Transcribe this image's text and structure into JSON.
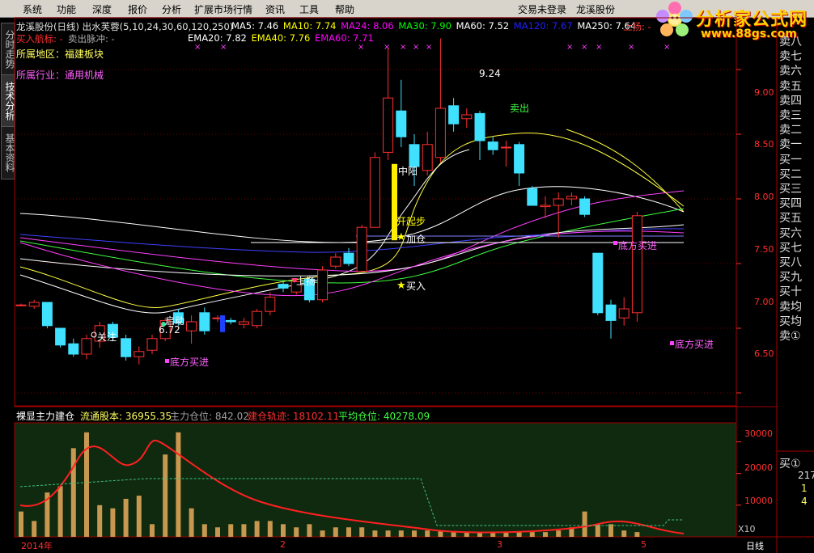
{
  "menu": [
    "系统",
    "功能",
    "深度",
    "报价",
    "分析",
    "扩展市场行情",
    "资讯",
    "工具",
    "帮助"
  ],
  "login_status": "交易未登录",
  "stock_name_top": "龙溪股份",
  "logo": {
    "title": "分析家公式网",
    "url": "www.88gs.com"
  },
  "side_tabs": [
    "分时走势",
    "技术分析",
    "基本资料"
  ],
  "header": {
    "title": "龙溪股份(日线) 出水芙蓉(5,10,24,30,60,120,250)",
    "ma": [
      {
        "label": "MA5: 7.46",
        "color": "#ffffff"
      },
      {
        "label": "MA10: 7.74",
        "color": "#ffff00"
      },
      {
        "label": "MA24: 8.06",
        "color": "#ff00ff"
      },
      {
        "label": "MA30: 7.90",
        "color": "#00ff00"
      },
      {
        "label": "MA60: 7.52",
        "color": "#ffffff"
      },
      {
        "label": "MA120: 7.67",
        "color": "#2020ff"
      },
      {
        "label": "MA250: 7.64",
        "color": "#ffffff"
      }
    ],
    "shangyang": "上扬: -",
    "buy_mark": "买入航标: -",
    "sell_pulse": "卖出脉冲: -",
    "ema": [
      {
        "label": "EMA20: 7.82",
        "color": "#ffffff"
      },
      {
        "label": "EMA40: 7.76",
        "color": "#ffff00"
      },
      {
        "label": "EMA60: 7.71",
        "color": "#ff00ff"
      }
    ]
  },
  "info": {
    "region": "所属地区：福建板块",
    "industry": "所属行业：通用机械"
  },
  "price_axis": [
    "9.00",
    "8.50",
    "8.00",
    "7.50",
    "7.00",
    "6.50"
  ],
  "bid_ask": [
    "卖八",
    "卖七",
    "卖六",
    "卖五",
    "卖四",
    "卖三",
    "卖二",
    "卖一",
    "买一",
    "买二",
    "买三",
    "买四",
    "买五",
    "买六",
    "买七",
    "买八",
    "买九",
    "买十",
    "卖均",
    "买均",
    "卖①"
  ],
  "annotations": {
    "high": "9.24",
    "low": "6.72",
    "guanzhu": "关注",
    "qidong": "启动",
    "shangyang": "上扬",
    "mairu": "买入",
    "jiacang": "加仓",
    "kaiqibu": "开起步",
    "zhongyang": "中阳",
    "maichu": "卖出",
    "difang1": "底方买进",
    "difang2": "底方买进",
    "difang3": "底方买进"
  },
  "sub": {
    "title": "裸显主力建仓",
    "liutong": "流通股本: 36955.35",
    "zhuli": "主力仓位: 842.02",
    "jiancang": "建仓轨迹: 18102.11",
    "pingjun": "平均仓位: 40278.09",
    "axis": [
      "30000",
      "20000",
      "10000"
    ],
    "x10": "X10"
  },
  "xaxis": {
    "year": "2014年",
    "m2": "2",
    "m3": "3",
    "m5": "5",
    "period": "日线"
  },
  "right_bottom": {
    "label": "买①",
    "v1": "217",
    "v2": "1",
    "v3": "4"
  },
  "chart_data": {
    "type": "candlestick",
    "ylim": [
      6.4,
      9.4
    ],
    "candles": [
      [
        7.18,
        7.18,
        7.19,
        7.17
      ],
      [
        7.17,
        7.2,
        7.22,
        7.15
      ],
      [
        7.2,
        7.02,
        7.2,
        7.0
      ],
      [
        7.0,
        6.87,
        7.0,
        6.85
      ],
      [
        6.88,
        6.8,
        6.92,
        6.78
      ],
      [
        6.8,
        6.92,
        6.95,
        6.76
      ],
      [
        6.9,
        7.02,
        7.05,
        6.85
      ],
      [
        7.03,
        6.93,
        7.05,
        6.9
      ],
      [
        6.92,
        6.78,
        6.95,
        6.75
      ],
      [
        6.78,
        6.82,
        6.86,
        6.72
      ],
      [
        6.83,
        6.92,
        6.95,
        6.8
      ],
      [
        6.92,
        7.06,
        7.08,
        6.9
      ],
      [
        7.12,
        7.04,
        7.15,
        7.02
      ],
      [
        6.98,
        7.05,
        7.1,
        6.88
      ],
      [
        7.12,
        6.98,
        7.16,
        6.95
      ],
      [
        7.08,
        7.08,
        7.1,
        7.05
      ],
      [
        7.06,
        7.05,
        7.08,
        7.03
      ],
      [
        7.03,
        7.05,
        7.08,
        7.0
      ],
      [
        7.02,
        7.13,
        7.15,
        7.0
      ],
      [
        7.13,
        7.24,
        7.28,
        7.1
      ],
      [
        7.34,
        7.31,
        7.36,
        7.28
      ],
      [
        7.28,
        7.36,
        7.38,
        7.26
      ],
      [
        7.38,
        7.22,
        7.4,
        7.2
      ],
      [
        7.22,
        7.45,
        7.48,
        7.2
      ],
      [
        7.48,
        7.55,
        7.58,
        7.46
      ],
      [
        7.58,
        7.5,
        7.62,
        7.48
      ],
      [
        7.44,
        7.78,
        7.8,
        7.44
      ],
      [
        7.78,
        8.32,
        8.36,
        7.78
      ],
      [
        8.36,
        8.78,
        9.17,
        8.3
      ],
      [
        8.68,
        8.48,
        8.92,
        8.4
      ],
      [
        8.42,
        8.25,
        8.5,
        8.1
      ],
      [
        8.22,
        8.42,
        8.52,
        8.18
      ],
      [
        8.32,
        8.7,
        9.24,
        8.28
      ],
      [
        8.72,
        8.58,
        8.78,
        8.52
      ],
      [
        8.62,
        8.65,
        8.7,
        8.55
      ],
      [
        8.66,
        8.45,
        8.68,
        8.3
      ],
      [
        8.44,
        8.38,
        8.48,
        8.34
      ],
      [
        8.4,
        8.4,
        8.45,
        8.25
      ],
      [
        8.42,
        8.2,
        8.44,
        8.1
      ],
      [
        8.08,
        7.95,
        8.1,
        7.95
      ],
      [
        7.94,
        7.95,
        8.02,
        7.85
      ],
      [
        7.95,
        8.0,
        8.05,
        7.7
      ],
      [
        8.0,
        8.02,
        8.05,
        7.95
      ],
      [
        8.0,
        7.88,
        8.02,
        7.86
      ],
      [
        7.58,
        7.12,
        7.58,
        7.1
      ],
      [
        7.18,
        7.06,
        7.22,
        6.92
      ],
      [
        7.08,
        7.15,
        7.24,
        7.02
      ],
      [
        7.12,
        7.87,
        7.9,
        7.05
      ]
    ],
    "volume": [
      8000,
      5000,
      14000,
      16000,
      28000,
      33000,
      10000,
      9000,
      12000,
      13000,
      4000,
      26000,
      33000,
      9000,
      4000,
      3000,
      4000,
      4000,
      5000,
      5000,
      4000,
      3000,
      4000,
      2000,
      3000,
      3000,
      3000,
      2000,
      2000,
      2000,
      2000,
      2000,
      2000,
      1500,
      1500,
      1500,
      1500,
      1500,
      1500,
      1500,
      1500,
      2000,
      3000,
      8000,
      4000,
      4000,
      2000,
      1500
    ]
  }
}
